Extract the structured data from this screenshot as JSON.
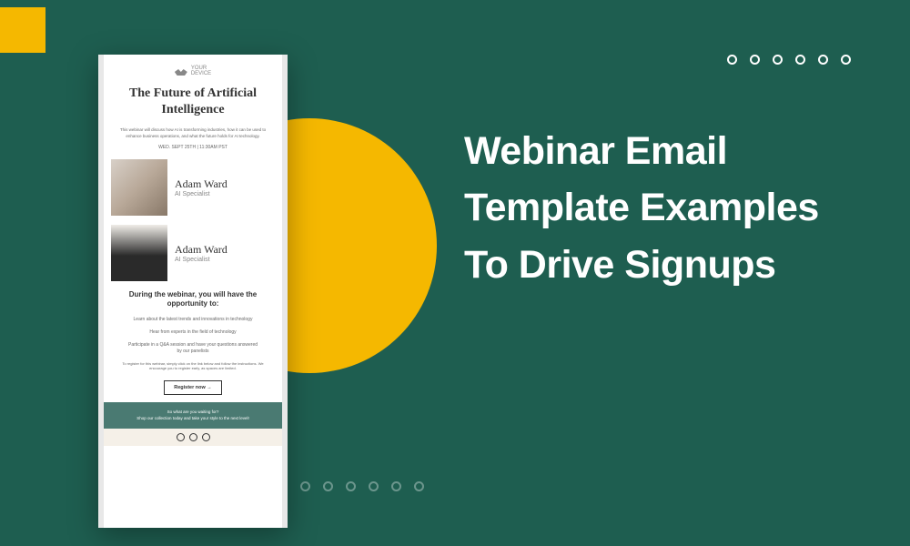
{
  "headline": "Webinar Email Template Examples To Drive Signups",
  "email": {
    "logo": {
      "line1": "YOUR",
      "line2": "DEVICE"
    },
    "title": "The Future of Artificial Intelligence",
    "description": "This webinar will discuss how AI is transforming industries, how it can be used to enhance business operations, and what the future holds for AI technology.",
    "date": "WED. SEPT 25TH | 11:30AM PST",
    "speakers": [
      {
        "name": "Adam Ward",
        "role": "AI Specialist"
      },
      {
        "name": "Adam Ward",
        "role": "AI Specialist"
      }
    ],
    "subheading": "During the webinar, you will have the opportunity to:",
    "bullets": [
      "Learn about the latest trends and innovations in technology",
      "Hear from experts in the field of technology",
      "Participate in a Q&A session and have your questions answered by our panelists"
    ],
    "register_desc": "To register for this webinar, simply click on the link below and follow the instructions. We encourage you to register early, as spaces are limited.",
    "register_button": "Register now →",
    "footer_line1": "So what are you waiting for?",
    "footer_line2": "Shop our collection today and take your style to the next level!"
  }
}
